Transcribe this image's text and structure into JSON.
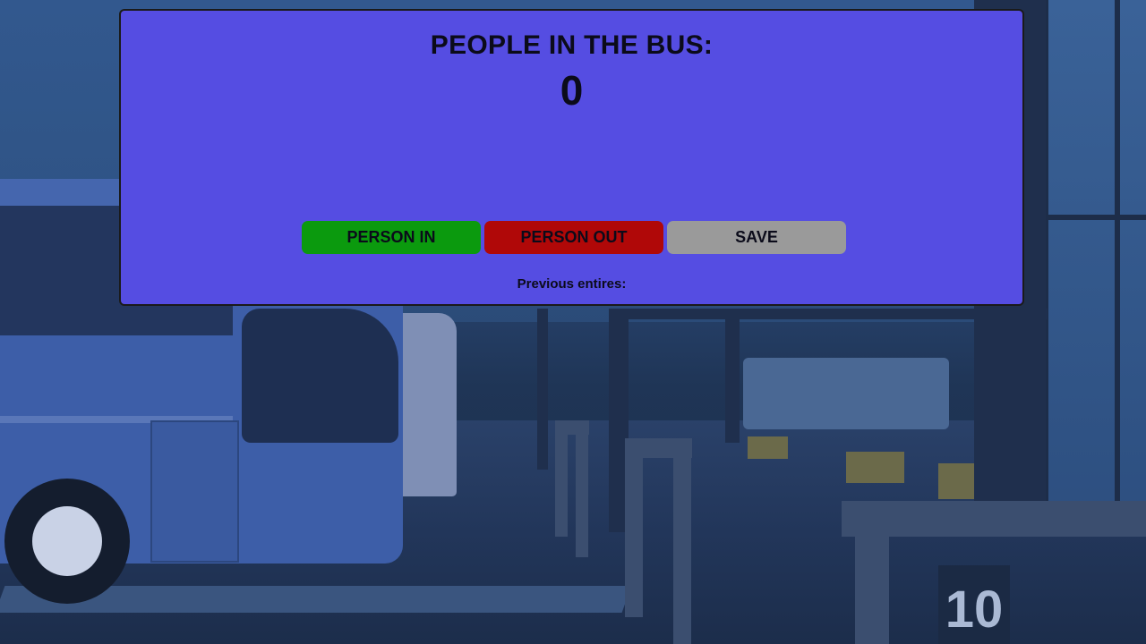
{
  "header": {
    "title": "PEOPLE IN THE BUS:",
    "count": "0"
  },
  "actions": {
    "person_in_label": "PERSON IN",
    "person_out_label": "PERSON OUT",
    "save_label": "SAVE"
  },
  "history": {
    "label": "Previous entires:"
  },
  "background": {
    "bay_number": "10"
  },
  "colors": {
    "panel": "#554de2",
    "person_in": "#0b9a0e",
    "person_out": "#b00808",
    "save": "#9a9a9a"
  }
}
